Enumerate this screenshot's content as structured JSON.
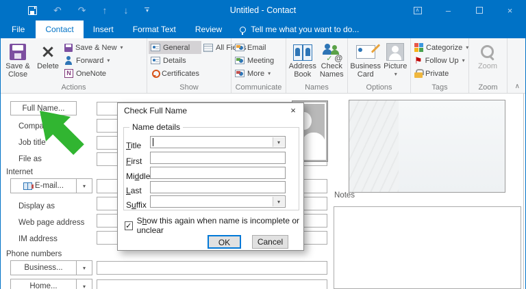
{
  "window": {
    "title": "Untitled - Contact"
  },
  "icons": {
    "undo": "↶",
    "redo": "↷",
    "up": "↑",
    "down": "↓",
    "dropdown": "▾",
    "minimize": "–",
    "close": "×",
    "delete_x": "×",
    "flag": "⚑",
    "check": "✓",
    "at": "@",
    "collapse": "∧",
    "onenote_n": "N"
  },
  "tabs": {
    "file": "File",
    "contact": "Contact",
    "insert": "Insert",
    "format_text": "Format Text",
    "review": "Review",
    "tell_me": "Tell me what you want to do..."
  },
  "ribbon": {
    "groups": {
      "actions": {
        "label": "Actions",
        "save_close": "Save & Close",
        "delete": "Delete",
        "save_new": "Save & New",
        "forward": "Forward",
        "onenote": "OneNote"
      },
      "show": {
        "label": "Show",
        "general": "General",
        "details": "Details",
        "certificates": "Certificates",
        "all_fields": "All Fields"
      },
      "communicate": {
        "label": "Communicate",
        "email": "Email",
        "meeting": "Meeting",
        "more": "More"
      },
      "names": {
        "label": "Names",
        "address_book": "Address Book",
        "check_names": "Check Names"
      },
      "options": {
        "label": "Options",
        "business_card": "Business Card",
        "picture": "Picture"
      },
      "tags": {
        "label": "Tags",
        "categorize": "Categorize",
        "follow_up": "Follow Up",
        "private": "Private"
      },
      "zoom": {
        "label": "Zoom",
        "zoom": "Zoom"
      }
    }
  },
  "form": {
    "full_name": "Full Name...",
    "company": "Company",
    "job_title": "Job title",
    "file_as": "File as",
    "internet_header": "Internet",
    "email": "E-mail...",
    "display_as": "Display as",
    "web_page": "Web page address",
    "im_address": "IM address",
    "phone_header": "Phone numbers",
    "business": "Business...",
    "home": "Home...",
    "notes": "Notes"
  },
  "dialog": {
    "title": "Check Full Name",
    "group": "Name details",
    "fields": [
      {
        "pre": "",
        "key": "T",
        "post": "itle"
      },
      {
        "pre": "",
        "key": "F",
        "post": "irst"
      },
      {
        "pre": "Mi",
        "key": "d",
        "post": "dle"
      },
      {
        "pre": "",
        "key": "L",
        "post": "ast"
      },
      {
        "pre": "S",
        "key": "u",
        "post": "ffix"
      }
    ],
    "checkbox": {
      "pre": "S",
      "key": "h",
      "post": "ow this again when name is incomplete or unclear"
    },
    "ok": "OK",
    "cancel": "Cancel"
  },
  "colors": {
    "titlebar": "#0072C6",
    "accent": "#0078D7",
    "arrow_green": "#31B531",
    "selected_gray": "#D4D2D5"
  }
}
